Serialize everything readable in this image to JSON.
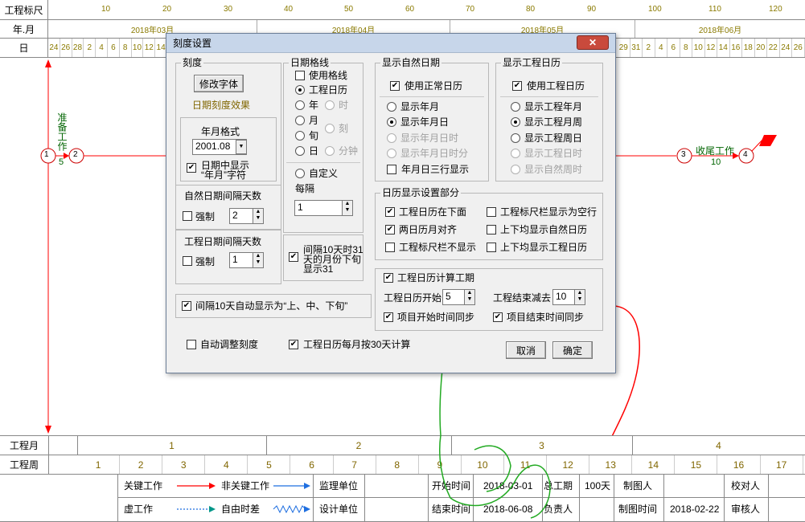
{
  "header": {
    "row1_label": "工程标尺",
    "row2_label": "年.月",
    "row3_label": "日",
    "ruler_ticks": [
      "10",
      "20",
      "30",
      "40",
      "50",
      "60",
      "70",
      "80",
      "90",
      "100",
      "110",
      "120"
    ],
    "months": [
      "2018年03月",
      "2018年04月",
      "2018年05月",
      "2018年06月"
    ],
    "days_left": [
      "24",
      "26",
      "28",
      "2",
      "4",
      "6",
      "8",
      "10",
      "12",
      "14"
    ],
    "days_right": [
      "29",
      "31",
      "2",
      "4",
      "6",
      "8",
      "10",
      "12",
      "14",
      "16",
      "18",
      "20",
      "22",
      "24",
      "26"
    ]
  },
  "network": {
    "node1": "1",
    "node2": "2",
    "node3": "3",
    "node4": "4",
    "left_task_name": "准备工作",
    "left_task_duration": "5",
    "right_task_name": "收尾工作",
    "right_task_duration": "10"
  },
  "dialog": {
    "title": "刻度设置",
    "close_label": "✕",
    "scale": {
      "title": "刻度",
      "font_button": "修改字体",
      "effect": "日期刻度效果",
      "format_label": "年月格式",
      "format_value": "2001.08",
      "show_ym_line1": "日期中显示",
      "show_ym_line2": "“年月”字符",
      "natural_interval_title": "自然日期间隔天数",
      "natural_force": "强制",
      "natural_value": "2",
      "work_interval_title": "工程日期间隔天数",
      "work_force": "强制",
      "work_value": "1",
      "auto_10days": "间隔10天自动显示为“上、中、下旬”"
    },
    "gridlines": {
      "title": "日期格线",
      "use_grid": "使用格线",
      "work_calendar": "工程日历",
      "year": "年",
      "hour": "时",
      "month": "月",
      "quarter": "刻",
      "xun": "旬",
      "day": "日",
      "minute": "分钟",
      "custom": "自定义",
      "every": "每隔",
      "every_value": "1",
      "show31_line1": "间隔10天时31",
      "show31_line2": "天的月份下旬",
      "show31_line3": "显示31"
    },
    "natural_date": {
      "title": "显示自然日期",
      "use_normal": "使用正常日历",
      "show_ym": "显示年月",
      "show_ymd": "显示年月日",
      "show_ymdh": "显示年月日时",
      "show_ymdhm": "显示年月日时分",
      "three_lines": "年月日三行显示"
    },
    "work_date": {
      "title": "显示工程日历",
      "use_work": "使用工程日历",
      "show_ym": "显示工程年月",
      "show_ymw": "显示工程月周",
      "show_yw": "显示工程周日",
      "show_wh": "显示工程日时",
      "show_nw": "显示自然周时"
    },
    "calendar_display": {
      "title": "日历显示设置部分",
      "work_below": "工程日历在下面",
      "ruler_blank": "工程标尺栏显示为空行",
      "align_months": "两日历月对齐",
      "both_natural": "上下均显示自然日历",
      "ruler_hide": "工程标尺栏不显示",
      "both_work": "上下均显示工程日历"
    },
    "calc": {
      "calc_period": "工程日历计算工期",
      "start_label": "工程日历开始",
      "start_value": "5",
      "end_minus_label": "工程结束减去",
      "end_minus_value": "10",
      "sync_start": "项目开始时间同步",
      "sync_end": "项目结束时间同步"
    },
    "auto_adjust": "自动调整刻度",
    "month30": "工程日历每月按30天计算",
    "cancel": "取消",
    "ok": "确定"
  },
  "footer": {
    "work_month_label": "工程月",
    "work_months": [
      "1",
      "2",
      "3",
      "4"
    ],
    "work_week_label": "工程周",
    "work_weeks": [
      "1",
      "2",
      "3",
      "4",
      "5",
      "6",
      "7",
      "8",
      "9",
      "10",
      "11",
      "12",
      "13",
      "14",
      "15",
      "16",
      "17"
    ],
    "legend_critical": "关键工作",
    "legend_noncritical": "非关键工作",
    "legend_virtual": "虚工作",
    "legend_free": "自由时差",
    "supervisor": "监理单位",
    "designer": "设计单位",
    "start_time_label": "开始时间",
    "start_time": "2018-03-01",
    "end_time_label": "结束时间",
    "end_time": "2018-06-08",
    "total_label": "总工期",
    "total_value": "100天",
    "owner_label": "负责人",
    "drawer_label": "制图人",
    "draw_time_label": "制图时间",
    "draw_time": "2018-02-22",
    "checker_label": "校对人",
    "reviewer_label": "审核人"
  },
  "colors": {
    "critical": "#ff0000",
    "noncritical": "#1f6fe0",
    "duration_text": "#006400",
    "annotation_red": "#ff0000",
    "annotation_green": "#22aa22"
  }
}
